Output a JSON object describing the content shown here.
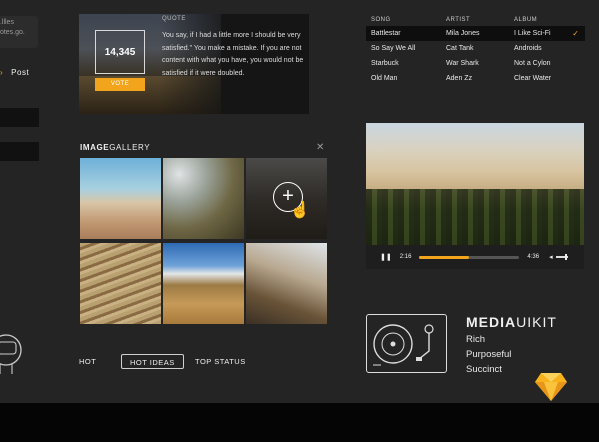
{
  "left": {
    "fragment_text": "..llles\ntotes.go.",
    "nav_label": "Post"
  },
  "quote_card": {
    "count": "14,345",
    "vote_label": "VOTE",
    "label": "QUOTE",
    "text": "You say, if I had a little more I should be very satisfied.\" You make a mistake. If you are not content with what you have, you would not be satisfied if it were doubled."
  },
  "songs": {
    "headers": [
      "SONG",
      "ARTIST",
      "ALBUM"
    ],
    "rows": [
      {
        "song": "Battlestar",
        "artist": "Mila Jones",
        "album": "I Like Sci-Fi",
        "selected": true
      },
      {
        "song": "So Say We All",
        "artist": "Cat Tank",
        "album": "Androids",
        "selected": false
      },
      {
        "song": "Starbuck",
        "artist": "War Shark",
        "album": "Not a Cylon",
        "selected": false
      },
      {
        "song": "Old Man",
        "artist": "Aden Zz",
        "album": "Clear Water",
        "selected": false
      }
    ]
  },
  "gallery": {
    "title_bold": "IMAGE",
    "title_rest": "GALLERY",
    "close_icon": "close-icon",
    "add_icon": "plus-circle-icon"
  },
  "tabs": [
    {
      "label": "HOT",
      "active": false
    },
    {
      "label": "HOT IDEAS",
      "active": true
    },
    {
      "label": "TOP STATUS",
      "active": false
    }
  ],
  "player": {
    "current_time": "2:16",
    "total_time": "4:36",
    "progress": 0.5
  },
  "brand": {
    "title_bold": "MEDIA",
    "title_rest": "UIKIT",
    "lines": [
      "Rich",
      "Purposeful",
      "Succinct"
    ]
  },
  "colors": {
    "accent": "#f2a51c",
    "background": "#242424"
  }
}
